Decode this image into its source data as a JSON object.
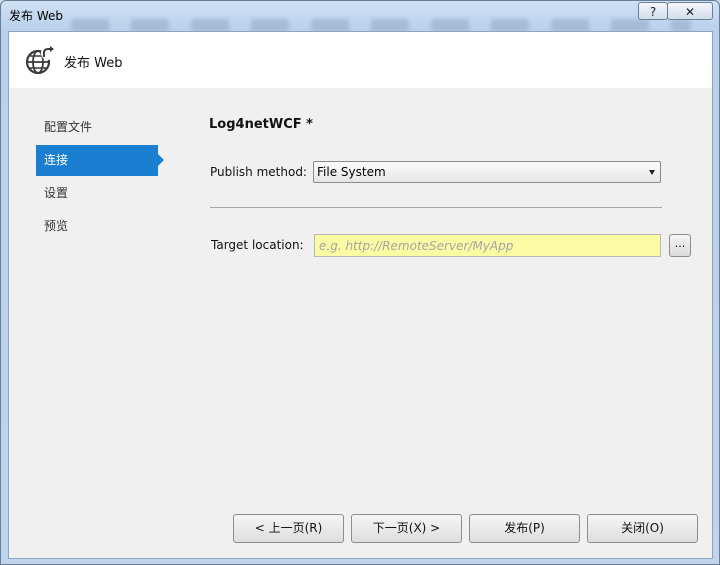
{
  "window": {
    "title": "发布 Web",
    "help_label": "?",
    "close_label": "✕"
  },
  "header": {
    "icon": "globe-publish-icon",
    "title": "发布 Web"
  },
  "nav": {
    "items": [
      {
        "label": "配置文件",
        "active": false
      },
      {
        "label": "连接",
        "active": true
      },
      {
        "label": "设置",
        "active": false
      },
      {
        "label": "预览",
        "active": false
      }
    ]
  },
  "main": {
    "profile_name": "Log4netWCF *",
    "publish_method": {
      "label": "Publish method:",
      "value": "File System"
    },
    "target_location": {
      "label": "Target location:",
      "value": "",
      "placeholder": "e.g. http://RemoteServer/MyApp"
    },
    "browse_label": "..."
  },
  "footer": {
    "prev_label": "< 上一页(R)",
    "next_label": "下一页(X) >",
    "publish_label": "发布(P)",
    "close_label": "关闭(O)"
  },
  "colors": {
    "accent": "#1a7fd0",
    "input_highlight": "#fbfba3"
  }
}
